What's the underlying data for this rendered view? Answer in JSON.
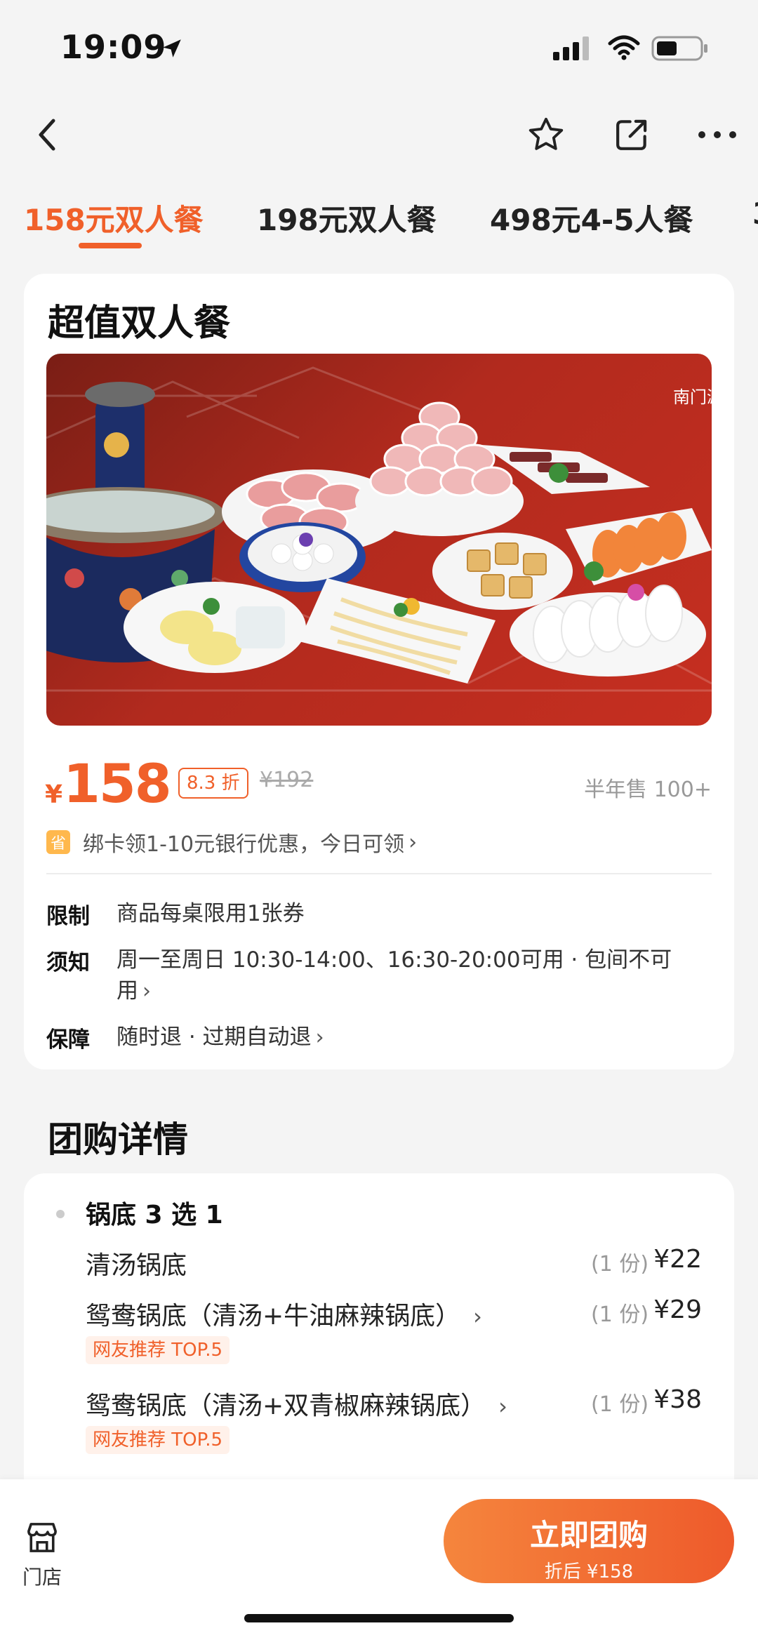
{
  "status_bar": {
    "time": "19:09"
  },
  "tabs": [
    {
      "label": "158元双人餐",
      "active": true
    },
    {
      "label": "198元双人餐",
      "active": false
    },
    {
      "label": "498元4-5人餐",
      "active": false
    }
  ],
  "deal": {
    "title": "超值双人餐",
    "hero_logo": "南门涮肉",
    "price_symbol": "¥",
    "price": "158",
    "discount": "8.3 折",
    "original_price": "¥192",
    "sold": "半年售 100+",
    "bank_badge": "省",
    "bank_offer": "绑卡领1-10元银行优惠，今日可领",
    "rules": [
      {
        "label": "限制",
        "text": "商品每桌限用1张券"
      },
      {
        "label": "须知",
        "text": "周一至周日 10:30-14:00、16:30-20:00可用 · 包间不可用"
      },
      {
        "label": "保障",
        "text": "随时退 · 过期自动退"
      }
    ]
  },
  "details": {
    "section_title": "团购详情",
    "group_title": "锅底 3 选 1",
    "items": [
      {
        "name": "清汤锅底",
        "qty": "(1 份)",
        "price": "¥22",
        "tag": ""
      },
      {
        "name": "鸳鸯锅底（清汤+牛油麻辣锅底）",
        "qty": "(1 份)",
        "price": "¥29",
        "tag": "网友推荐 TOP.5"
      },
      {
        "name": "鸳鸯锅底（清汤+双青椒麻辣锅底）",
        "qty": "(1 份)",
        "price": "¥38",
        "tag": "网友推荐 TOP.5"
      }
    ]
  },
  "bottom_bar": {
    "store_label": "门店",
    "buy_label": "立即团购",
    "buy_sub": "折后 ¥158"
  },
  "colors": {
    "accent": "#f0602a",
    "background": "#f4f4f4"
  }
}
